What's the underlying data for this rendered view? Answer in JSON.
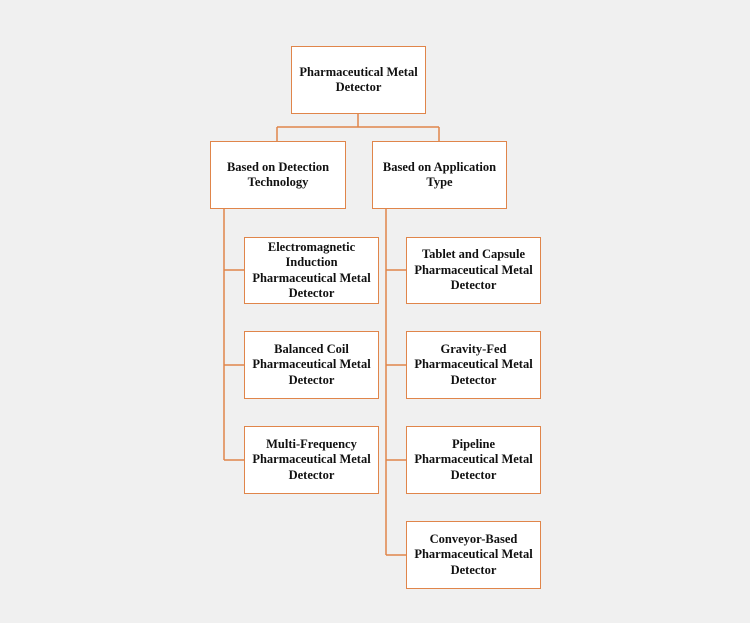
{
  "colors": {
    "line": "#e0854a",
    "background": "#f0f0f0",
    "box": "#ffffff"
  },
  "root": {
    "label": "Pharmaceutical Metal Detector"
  },
  "branches": [
    {
      "label": "Based on Detection Technology",
      "children": [
        "Electromagnetic Induction Pharmaceutical Metal Detector",
        "Balanced Coil Pharmaceutical Metal Detector",
        "Multi-Frequency Pharmaceutical Metal Detector"
      ]
    },
    {
      "label": "Based on Application Type",
      "children": [
        "Tablet and Capsule Pharmaceutical Metal Detector",
        "Gravity-Fed Pharmaceutical Metal Detector",
        "Pipeline Pharmaceutical Metal Detector",
        "Conveyor-Based Pharmaceutical Metal Detector"
      ]
    }
  ]
}
